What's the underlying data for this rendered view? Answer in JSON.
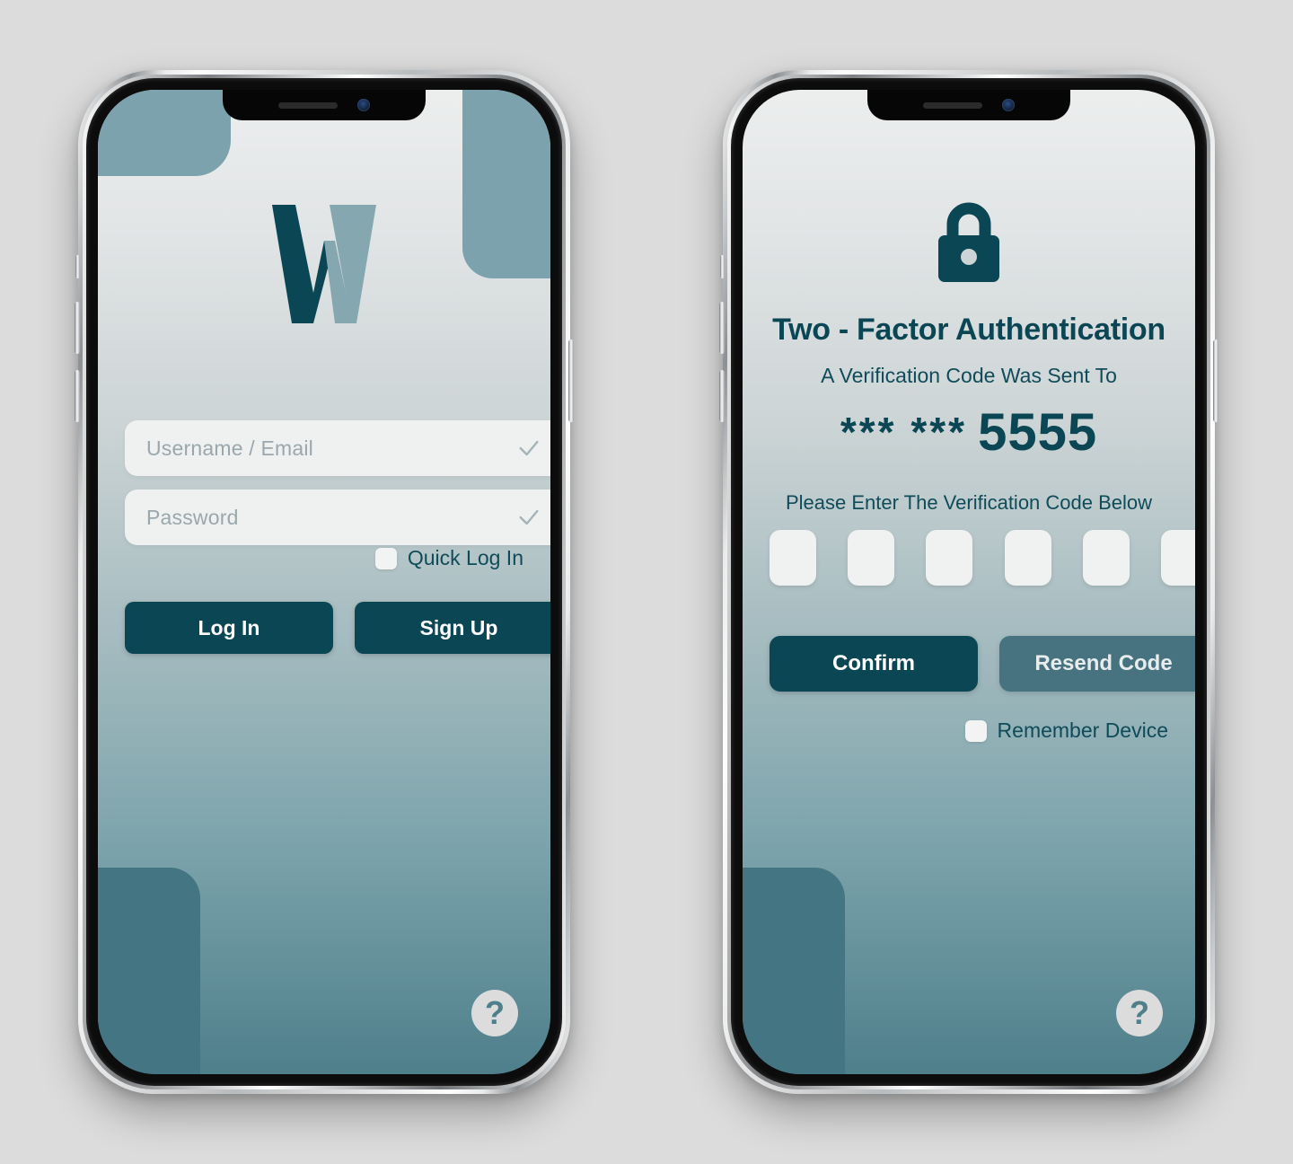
{
  "palette": {
    "page_background": "#dcdcdc",
    "brand_dark_teal": "#0b4654",
    "brand_mid_teal": "#46737f",
    "brand_light_teal": "#7ca3ad",
    "deco_deep_teal": "#437682",
    "field_background": "#eff0f0",
    "placeholder_text": "#9aa8ad",
    "label_text": "#0f4b59"
  },
  "login": {
    "logo": {
      "letter": "W",
      "left_color": "#0b4654",
      "right_color": "#85a8b0",
      "name": "w-logo"
    },
    "fields": [
      {
        "name": "username-email",
        "placeholder": "Username /  Email",
        "value": "",
        "icon": "check-icon"
      },
      {
        "name": "password",
        "placeholder": "Password",
        "value": "",
        "icon": "check-icon"
      }
    ],
    "quick_login": {
      "label": "Quick Log In",
      "checked": false
    },
    "buttons": [
      {
        "name": "log-in",
        "label": "Log In"
      },
      {
        "name": "sign-up",
        "label": "Sign Up"
      }
    ],
    "help": {
      "label": "?",
      "icon": "question-mark-icon"
    }
  },
  "tfa": {
    "lock_icon": "lock-icon",
    "title": "Two - Factor Authentication",
    "subtitle": "A Verification Code Was Sent To",
    "masked_number": {
      "stars": "*** ***",
      "digits": "5555"
    },
    "hint": "Please Enter The Verification Code Below",
    "code_cells": [
      "",
      "",
      "",
      "",
      "",
      ""
    ],
    "buttons": [
      {
        "name": "confirm",
        "label": "Confirm"
      },
      {
        "name": "resend-code",
        "label": "Resend Code"
      }
    ],
    "remember_device": {
      "label": "Remember Device",
      "checked": false
    },
    "help": {
      "label": "?",
      "icon": "question-mark-icon"
    }
  }
}
